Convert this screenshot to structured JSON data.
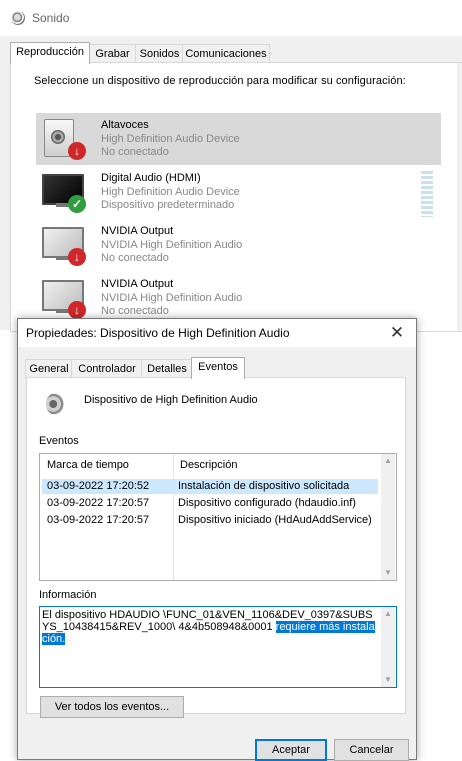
{
  "sonido": {
    "title": "Sonido",
    "tabs": [
      "Reproducción",
      "Grabar",
      "Sonidos",
      "Comunicaciones"
    ],
    "instruction": "Seleccione un dispositivo de reproducción para modificar su configuración:",
    "devices": [
      {
        "name": "Altavoces",
        "line2": "High Definition Audio Device",
        "line3": "No conectado",
        "icon": "speaker-icon",
        "status": "disconnected"
      },
      {
        "name": "Digital Audio (HDMI)",
        "line2": "High Definition Audio Device",
        "line3": "Dispositivo predeterminado",
        "icon": "monitor-icon",
        "status": "default"
      },
      {
        "name": "NVIDIA Output",
        "line2": "NVIDIA High Definition Audio",
        "line3": "No conectado",
        "icon": "monitor-icon",
        "status": "disconnected"
      },
      {
        "name": "NVIDIA Output",
        "line2": "NVIDIA High Definition Audio",
        "line3": "No conectado",
        "icon": "monitor-icon",
        "status": "disconnected"
      }
    ]
  },
  "props": {
    "title": "Propiedades: Dispositivo de High Definition Audio",
    "close_glyph": "✕",
    "tabs": [
      "General",
      "Controlador",
      "Detalles",
      "Eventos"
    ],
    "device_name": "Dispositivo de High Definition Audio",
    "events_label": "Eventos",
    "columns": [
      "Marca de tiempo",
      "Descripción"
    ],
    "events": [
      {
        "time": "03-09-2022 17:20:52",
        "desc": "Instalación de dispositivo solicitada"
      },
      {
        "time": "03-09-2022 17:20:57",
        "desc": "Dispositivo configurado (hdaudio.inf)"
      },
      {
        "time": "03-09-2022 17:20:57",
        "desc": "Dispositivo iniciado (HdAudAddService)"
      }
    ],
    "info_label": "Información",
    "info_text": "El dispositivo HDAUDIO \\FUNC_01&VEN_1106&DEV_0397&SUBSYS_10438415&REV_1000\\ 4&4b508948&0001 ",
    "info_highlight": "requiere más instalación.",
    "view_all_button": "Ver todos los eventos...",
    "ok_button": "Aceptar",
    "cancel_button": "Cancelar"
  },
  "colors": {
    "accent": "#0078d7",
    "selection": "#cce8ff",
    "error": "#d0282a",
    "ok": "#2e9e3e"
  }
}
